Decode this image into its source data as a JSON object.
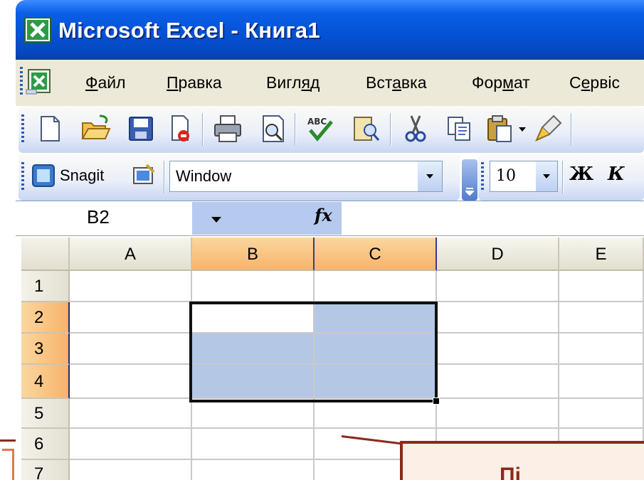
{
  "window": {
    "title": "Microsoft Excel - Книга1",
    "app_icon": "excel-icon"
  },
  "menu": {
    "icon": "workbook-icon",
    "items": [
      {
        "label": "Файл",
        "underline": "Ф"
      },
      {
        "label": "Правка",
        "underline": "П"
      },
      {
        "label": "Вигляд",
        "underline": "я"
      },
      {
        "label": "Вставка",
        "underline": "а"
      },
      {
        "label": "Формат",
        "underline": "м"
      },
      {
        "label": "Сервіс",
        "underline": "е"
      }
    ]
  },
  "toolbar_standard": {
    "buttons": [
      "new-icon",
      "open-icon",
      "save-icon",
      "permission-icon",
      "print-icon",
      "print-preview-icon",
      "spelling-icon",
      "research-icon",
      "cut-icon",
      "copy-icon",
      "paste-icon",
      "format-painter-icon"
    ]
  },
  "toolbar_snagit": {
    "label": "Snagit",
    "capture_mode": "Window"
  },
  "toolbar_format": {
    "font_size": "10",
    "bold_label": "Ж",
    "italic_label": "К"
  },
  "formula_bar": {
    "name_box": "B2",
    "fx_label": "fx",
    "formula": ""
  },
  "sheet": {
    "columns": [
      "A",
      "B",
      "C",
      "D",
      "E"
    ],
    "rows": [
      "1",
      "2",
      "3",
      "4",
      "5",
      "6",
      "7"
    ],
    "selected_columns": [
      "B",
      "C"
    ],
    "selected_rows": [
      "2",
      "3",
      "4"
    ],
    "active_cell": "B2",
    "selection_range": "B2:C4"
  },
  "callout": {
    "text": "Пі"
  },
  "colors": {
    "title_bar": "#0552d6",
    "selection_fill": "#b4c8e6",
    "header_selected": "#f8b36b",
    "callout_border": "#8b2a1c"
  }
}
